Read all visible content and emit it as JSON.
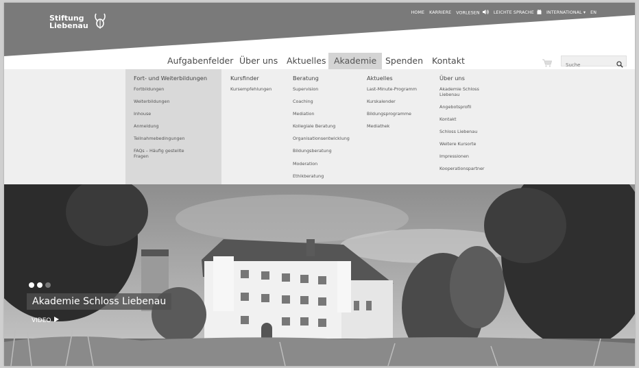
{
  "brand": {
    "line1": "Stiftung",
    "line2": "Liebenau"
  },
  "topnav": {
    "home": "HOME",
    "karriere": "KARRIERE",
    "vorlesen": "VORLESEN",
    "leichte": "LEICHTE SPRACHE",
    "international": "INTERNATIONAL ▾",
    "en": "EN"
  },
  "mainnav": {
    "items": [
      "Aufgabenfelder",
      "Über uns",
      "Aktuelles",
      "Akademie",
      "Spenden",
      "Kontakt"
    ],
    "active": "Akademie"
  },
  "search": {
    "placeholder": "Suche"
  },
  "mega": {
    "columns": [
      {
        "head": "Fort- und Weiterbildungen",
        "links": [
          "Fortbildungen",
          "Weiterbildungen",
          "Inhouse",
          "Anmeldung",
          "Teilnahmebedingungen",
          "FAQs – Häufig gestellte Fragen"
        ]
      },
      {
        "head": "Kursfinder",
        "links": [
          "Kursempfehlungen"
        ]
      },
      {
        "head": "Beratung",
        "links": [
          "Supervision",
          "Coaching",
          "Mediation",
          "Kollegiale Beratung",
          "Organisationsentwicklung",
          "Bildungsberatung",
          "Moderation",
          "Ethikberatung"
        ]
      },
      {
        "head": "Aktuelles",
        "links": [
          "Last-Minute-Programm",
          "Kurskalender",
          "Bildungsprogramme",
          "Mediathek"
        ]
      },
      {
        "head": "Über uns",
        "links": [
          "Akademie Schloss Liebenau",
          "Angebotsprofil",
          "Kontakt",
          "Schloss Liebenau",
          "Weitere Kursorte",
          "Impressionen",
          "Kooperationspartner"
        ]
      }
    ]
  },
  "hero": {
    "caption": "Akademie Schloss Liebenau",
    "video": "VIDEO",
    "slides": 3,
    "active_slide": 1
  },
  "colors": {
    "header_gray": "#7a7a7a",
    "active_nav": "#d4d4d4",
    "mega_bg": "#efefef",
    "first_col_bg": "#d9d9d9"
  },
  "icons": [
    "logo-icon",
    "speaker-icon",
    "gift-icon",
    "cart-icon",
    "search-icon",
    "play-icon"
  ]
}
